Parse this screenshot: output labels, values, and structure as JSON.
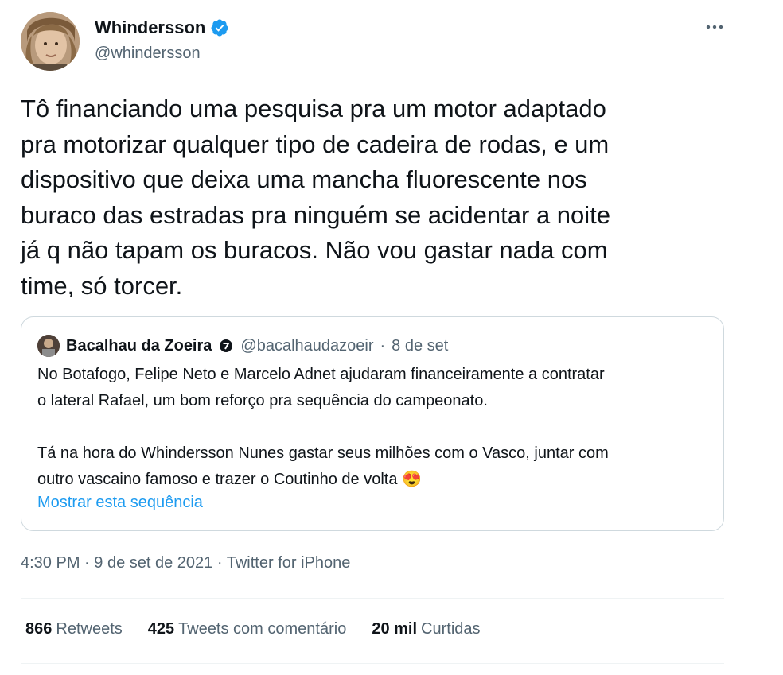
{
  "author": {
    "name": "Whindersson",
    "handle": "@whindersson"
  },
  "tweet": {
    "text": "Tô financiando uma pesquisa pra um motor adaptado\npra motorizar qualquer tipo de cadeira de rodas, e um\ndispositivo que deixa uma mancha fluorescente nos\nburaco das estradas pra ninguém se acidentar a noite\njá q não tapam os buracos. Não vou gastar nada com\ntime, só torcer."
  },
  "quoted": {
    "name": "Bacalhau da Zoeira",
    "handle": "@bacalhaudazoeir",
    "separator": "·",
    "date": "8 de set",
    "text": "No Botafogo, Felipe Neto e Marcelo Adnet ajudaram financeiramente a contratar\no lateral Rafael, um bom reforço pra sequência do campeonato.\n\nTá na hora do Whindersson Nunes gastar seus milhões com o Vasco, juntar com\noutro vascaino famoso e trazer o Coutinho de volta 😍",
    "show_thread": "Mostrar esta sequência"
  },
  "meta": {
    "time": "4:30 PM",
    "sep1": "·",
    "date": "9 de set de 2021",
    "sep2": "·",
    "source": "Twitter for iPhone"
  },
  "stats": {
    "retweets_count": "866",
    "retweets_label": "Retweets",
    "quotes_count": "425",
    "quotes_label": "Tweets com comentário",
    "likes_count": "20 mil",
    "likes_label": "Curtidas"
  },
  "colors": {
    "accent": "#1d9bf0",
    "secondary_text": "#536471",
    "border": "#cfd9de"
  },
  "icons": {
    "verified": "verified-badge-icon",
    "more": "more-options-icon",
    "quoted_badge": "circle-badge-icon"
  }
}
